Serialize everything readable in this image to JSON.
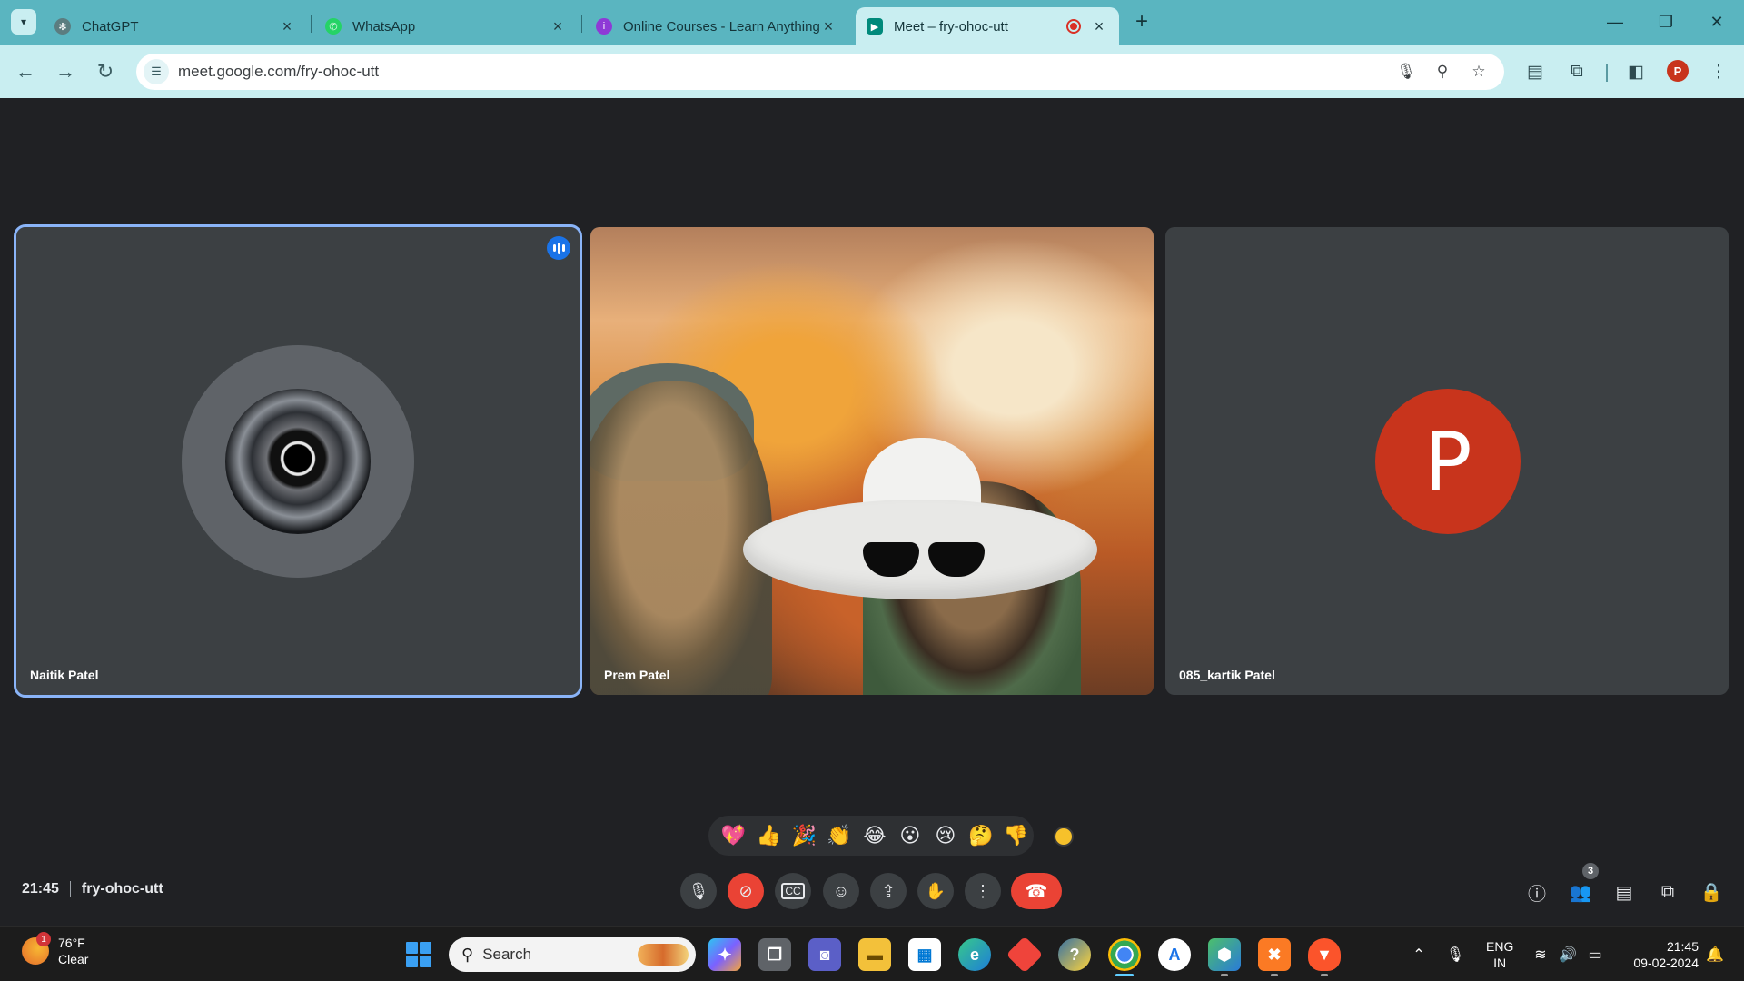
{
  "browser": {
    "tabs": [
      {
        "title": "ChatGPT",
        "icon": "chatgpt-icon",
        "active": false
      },
      {
        "title": "WhatsApp",
        "icon": "whatsapp-icon",
        "active": false
      },
      {
        "title": "Online Courses - Learn Anything",
        "icon": "courses-site-icon",
        "active": false
      },
      {
        "title": "Meet – fry-ohoc-utt",
        "icon": "google-meet-icon",
        "active": true,
        "recording": true
      }
    ],
    "url": "meet.google.com/fry-ohoc-utt",
    "profile_initial": "P",
    "colors": {
      "frame": "#5ab5c0",
      "toolbar": "#c9eef1"
    }
  },
  "meet": {
    "participants": [
      {
        "name": "Naitik Patel",
        "speaking": true,
        "video": false
      },
      {
        "name": "Prem Patel",
        "speaking": false,
        "video": true
      },
      {
        "name": "085_kartik Patel",
        "speaking": false,
        "video": false,
        "initial": "P",
        "avatar_color": "#c8341c"
      }
    ],
    "reactions": [
      "💖",
      "👍",
      "🎉",
      "👏",
      "😂",
      "😮",
      "😢",
      "🤔",
      "👎"
    ],
    "time": "21:45",
    "meeting_code": "fry-ohoc-utt",
    "people_count": "3",
    "colors": {
      "stage": "#202124",
      "tile": "#3c4043",
      "leave": "#ea4335",
      "speaking_outline": "#8ab4f8"
    }
  },
  "taskbar": {
    "weather": {
      "temp": "76°F",
      "condition": "Clear",
      "badge": "1"
    },
    "search_placeholder": "Search",
    "language": {
      "line1": "ENG",
      "line2": "IN"
    },
    "clock": {
      "time": "21:45",
      "date": "09-02-2024"
    },
    "apps": [
      "copilot-icon",
      "task-view-icon",
      "teams-chat-icon",
      "file-explorer-icon",
      "microsoft-store-icon",
      "edge-icon",
      "anydesk-icon",
      "python-icon",
      "chrome-icon",
      "arc-icon",
      "app-icon",
      "xampp-icon",
      "brave-icon"
    ]
  }
}
